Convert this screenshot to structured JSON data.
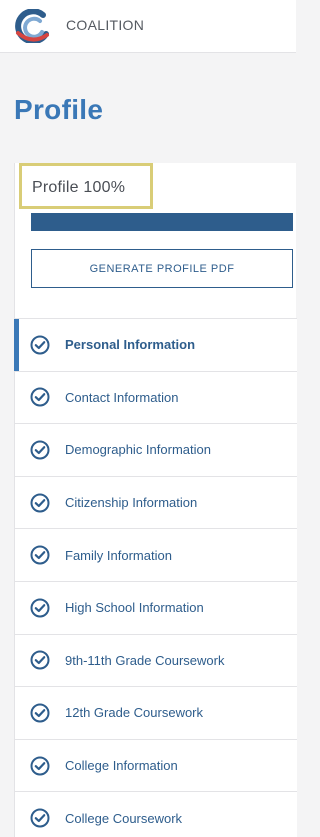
{
  "brand": {
    "name": "COALITION"
  },
  "page": {
    "title": "Profile"
  },
  "progress": {
    "label": "Profile 100%",
    "value": 1.0
  },
  "actions": {
    "generate_pdf": "GENERATE PROFILE PDF"
  },
  "colors": {
    "accent": "#3a78b7",
    "primary": "#2e5d8c",
    "highlight": "#d9cd77",
    "logo_blue": "#2e5d8c",
    "logo_red": "#d64541"
  },
  "sections": [
    {
      "label": "Personal Information",
      "active": true,
      "icon": "check-circle-icon"
    },
    {
      "label": "Contact Information",
      "active": false,
      "icon": "check-circle-icon"
    },
    {
      "label": "Demographic Information",
      "active": false,
      "icon": "check-circle-icon"
    },
    {
      "label": "Citizenship Information",
      "active": false,
      "icon": "check-circle-icon"
    },
    {
      "label": "Family Information",
      "active": false,
      "icon": "check-circle-icon"
    },
    {
      "label": "High School Information",
      "active": false,
      "icon": "check-circle-icon"
    },
    {
      "label": "9th-11th Grade Coursework",
      "active": false,
      "icon": "check-circle-icon"
    },
    {
      "label": "12th Grade Coursework",
      "active": false,
      "icon": "check-circle-icon"
    },
    {
      "label": "College Information",
      "active": false,
      "icon": "check-circle-icon"
    },
    {
      "label": "College Coursework",
      "active": false,
      "icon": "check-circle-icon"
    }
  ]
}
